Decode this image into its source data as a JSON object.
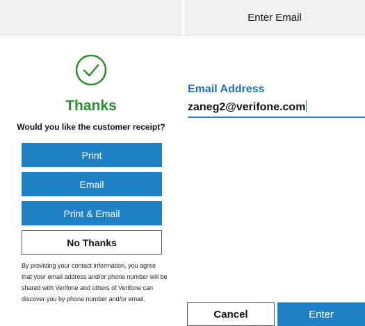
{
  "left": {
    "topbar_title": "",
    "icon": "check-circle-icon",
    "thanks": "Thanks",
    "question": "Would you like the customer receipt?",
    "buttons": {
      "print": "Print",
      "email": "Email",
      "print_email": "Print & Email",
      "no_thanks": "No Thanks"
    },
    "disclaimer": "By providing your contact information, you agree that your email address and/or phone number will be shared with Verifone and others of Verifone can discover you by phone number and/or email."
  },
  "right": {
    "topbar_title": "Enter Email",
    "field_label": "Email Address",
    "field_value": "zaneg2@verifone.com",
    "cancel": "Cancel",
    "enter": "Enter"
  },
  "colors": {
    "accent_blue": "#1f80c3",
    "label_blue": "#1f6fb5",
    "success_green": "#2e8b2e",
    "topbar_gray": "#f1f1f1"
  }
}
